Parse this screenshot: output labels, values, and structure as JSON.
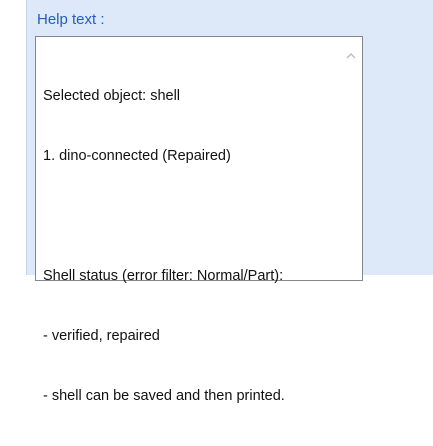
{
  "help_panel": {
    "title": "Help text :",
    "lines": [
      "Selected object: shell",
      "1. dino-connected (Repaired)",
      "",
      "Shell status (error filter: Normal/Part):",
      "- verified, repaired",
      "- shell can be saved and then printed."
    ]
  },
  "icons": {
    "scroll_up": "chevron-up-icon"
  },
  "colors": {
    "panel_background": "#dde8f8",
    "title_text": "#1f5fbf",
    "textbox_border": "#828790"
  }
}
